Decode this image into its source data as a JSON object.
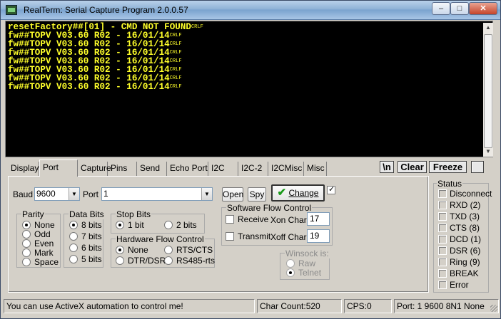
{
  "window": {
    "title": "RealTerm: Serial Capture Program 2.0.0.57"
  },
  "terminal": {
    "crlf_marker": "CRLF",
    "lines": [
      "resetFactory##[01] - CMD NOT FOUND",
      "fw##TOPV V03.60 R02 - 16/01/14",
      "fw##TOPV V03.60 R02 - 16/01/14",
      "fw##TOPV V03.60 R02 - 16/01/14",
      "fw##TOPV V03.60 R02 - 16/01/14",
      "fw##TOPV V03.60 R02 - 16/01/14",
      "fw##TOPV V03.60 R02 - 16/01/14",
      "fw##TOPV V03.60 R02 - 16/01/14"
    ]
  },
  "tabs": [
    "Display",
    "Port",
    "Capture",
    "Pins",
    "Send",
    "Echo Port",
    "I2C",
    "I2C-2",
    "I2CMisc",
    "Misc"
  ],
  "active_tab": "Port",
  "toolbar": {
    "newline_label": "\\n",
    "clear_label": "Clear",
    "freeze_label": "Freeze"
  },
  "port": {
    "baud_label": "Baud",
    "baud_value": "9600",
    "port_label": "Port",
    "port_value": "1",
    "open_label": "Open",
    "spy_label": "Spy",
    "change_label": "Change",
    "change_checked": true,
    "parity": {
      "caption": "Parity",
      "options": [
        "None",
        "Odd",
        "Even",
        "Mark",
        "Space"
      ],
      "selected": "None"
    },
    "databits": {
      "caption": "Data Bits",
      "options": [
        "8 bits",
        "7 bits",
        "6 bits",
        "5 bits"
      ],
      "selected": "8 bits"
    },
    "stopbits": {
      "caption": "Stop Bits",
      "options": [
        "1 bit",
        "2 bits"
      ],
      "selected": "1 bit"
    },
    "hardware_flow": {
      "caption": "Hardware Flow Control",
      "options": [
        "None",
        "RTS/CTS",
        "DTR/DSR",
        "RS485-rts"
      ],
      "selected": "None"
    },
    "software_flow": {
      "caption": "Software Flow Control",
      "receive_label": "Receive",
      "transmit_label": "Transmit",
      "xon_label": "Xon Char:",
      "xon_value": "17",
      "xoff_label": "Xoff Char:",
      "xoff_value": "19"
    },
    "winsock": {
      "caption": "Winsock is:",
      "options": [
        "Raw",
        "Telnet"
      ],
      "selected": "Telnet"
    }
  },
  "status_panel": {
    "caption": "Status",
    "items": [
      "Disconnect",
      "RXD (2)",
      "TXD (3)",
      "CTS (8)",
      "DCD (1)",
      "DSR (6)",
      "Ring (9)",
      "BREAK",
      "Error"
    ]
  },
  "statusbar": {
    "message": "You can use ActiveX automation to control me!",
    "char_count": "Char Count:520",
    "cps": "CPS:0",
    "port_info": "Port: 1 9600 8N1 None"
  },
  "colors": {
    "terminal_bg": "#000000",
    "terminal_text": "#ffff2a",
    "window_bg": "#d4d0c8"
  }
}
